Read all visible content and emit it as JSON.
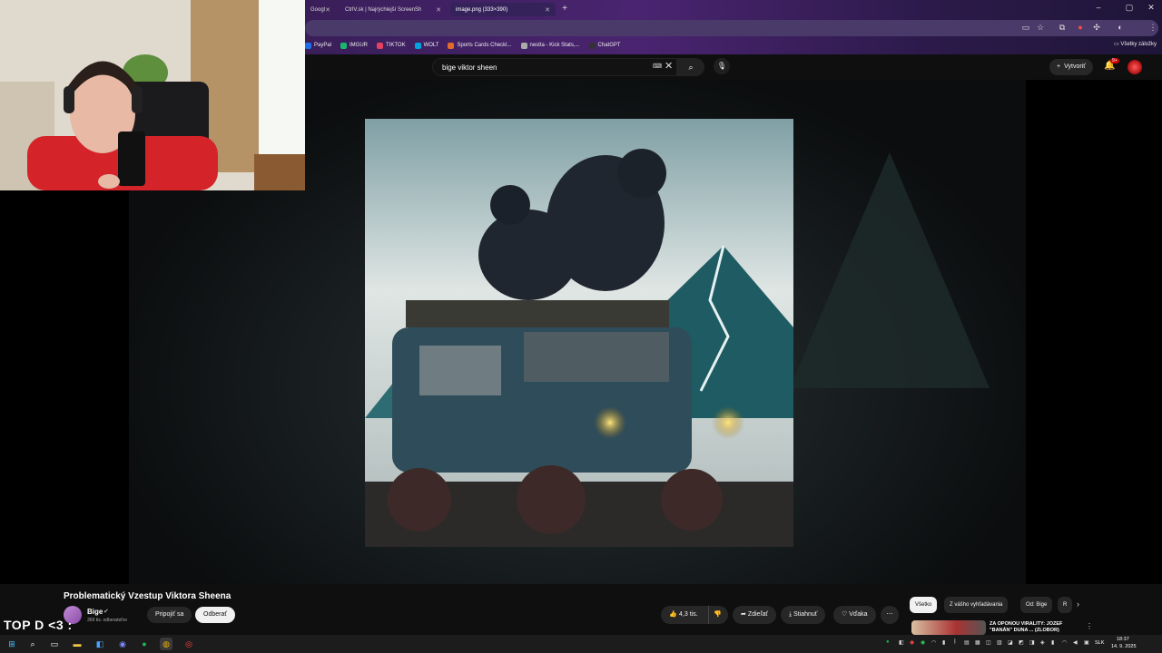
{
  "browser": {
    "tabs": [
      {
        "title": "Googl"
      },
      {
        "title": "CtrlV.sk | Najrýchlejší ScreenSh"
      },
      {
        "title": "image.png (333×390)",
        "active": true
      }
    ],
    "bookmarks": [
      {
        "label": "PayPal",
        "color": "#1f6feb"
      },
      {
        "label": "IMGUR",
        "color": "#1bb76e"
      },
      {
        "label": "TIKTOK",
        "color": "#e4405f"
      },
      {
        "label": "WOLT",
        "color": "#00a3e0"
      },
      {
        "label": "Sports Cards Checkl...",
        "color": "#e26b2a"
      },
      {
        "label": "nestta - Kick Stats,...",
        "color": "#aaaaaa"
      },
      {
        "label": "ChatGPT",
        "color": "#333333"
      }
    ],
    "all_bookmarks": "Všetky záložky"
  },
  "youtube": {
    "search_query": "bige viktor sheen",
    "create_label": "Vytvoriť",
    "notifications": "9+"
  },
  "video": {
    "title": "Problematický Vzestup Viktora Sheena",
    "channel": "Bige",
    "subscribers": "369 tis. odberateľov",
    "join_label": "Pripojiť sa",
    "subscribe_label": "Odberať",
    "likes": "4,3 tis.",
    "share_label": "Zdieľať",
    "download_label": "Stiahnuť",
    "thanks_label": "Vďaka",
    "overlay_text": "TOP D <3 :"
  },
  "sidebar": {
    "chips": [
      {
        "label": "Všetko",
        "active": true
      },
      {
        "label": "Z vášho vyhľadávania"
      },
      {
        "label": "Od: Bige"
      },
      {
        "label": "R"
      }
    ],
    "rec_title": "ZA OPONOU VIRALITY: JOZEF \"BANÁN\" DUNA ... (ZLOBOR)"
  },
  "taskbar": {
    "lang": "SLK",
    "time": "18:37",
    "date": "14. 9. 2025"
  },
  "colors": {
    "accent_red": "#cc0000",
    "browser_purple": "#3b1f5c",
    "yt_bg": "#0f0f0f"
  }
}
